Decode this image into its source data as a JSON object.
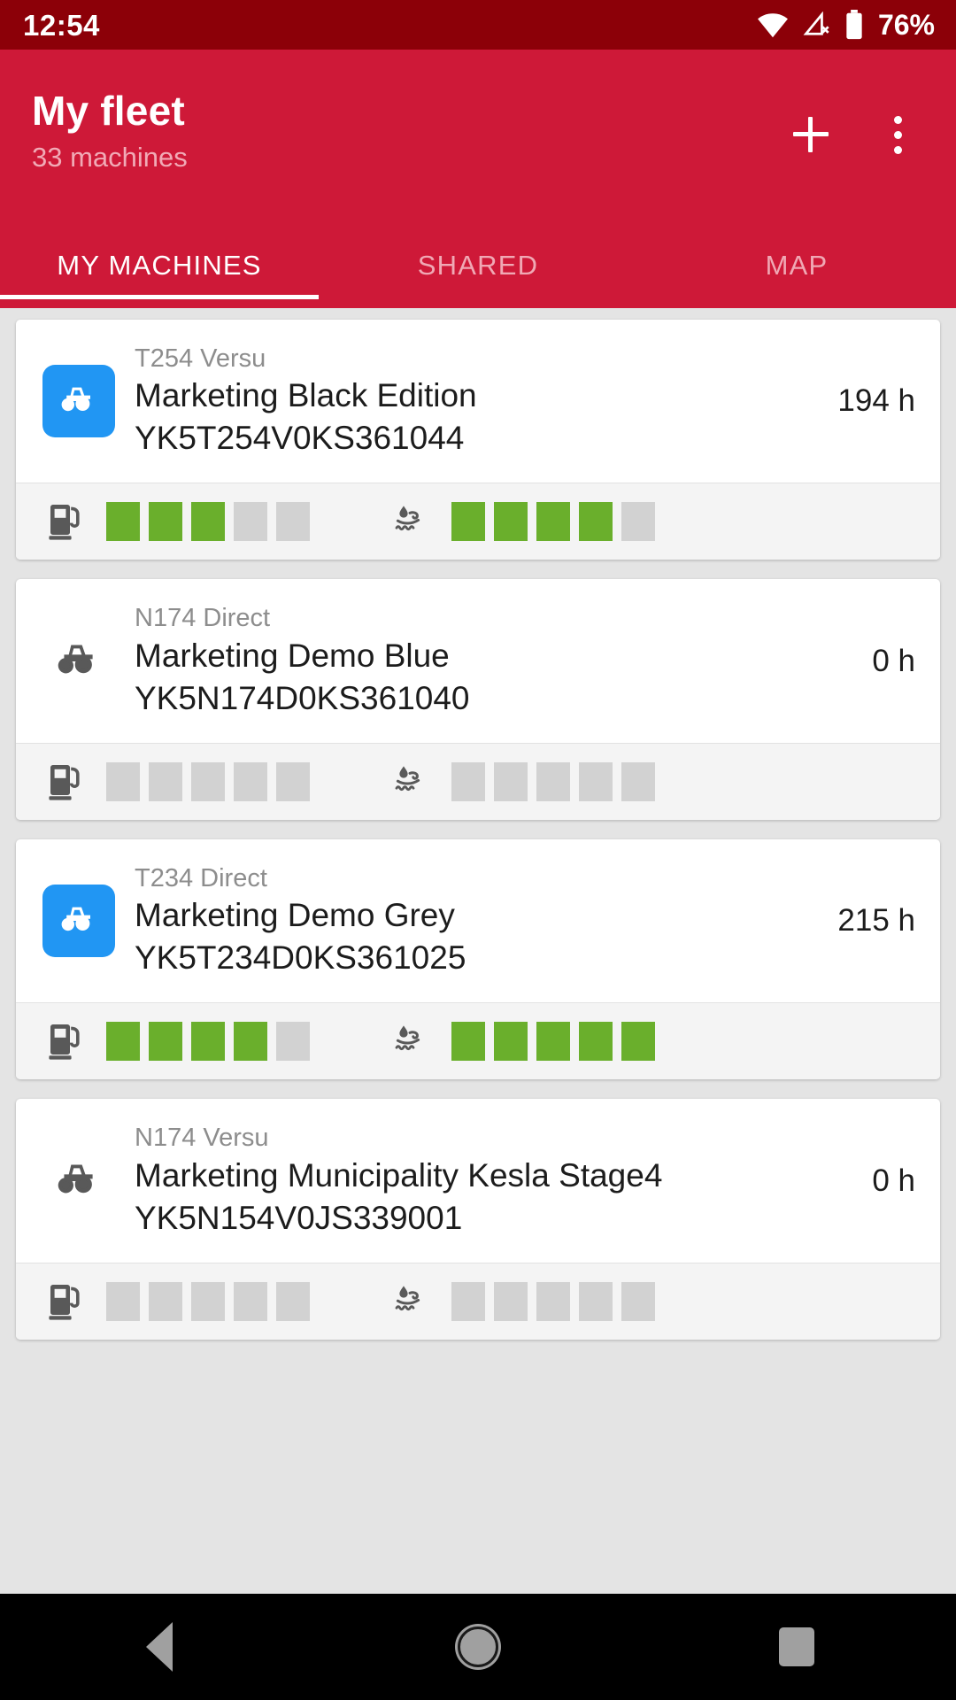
{
  "statusbar": {
    "time": "12:54",
    "battery_percent": "76%",
    "icons": [
      "wifi-icon",
      "cellular-off-icon",
      "battery-icon"
    ]
  },
  "appbar": {
    "title": "My fleet",
    "subtitle": "33 machines",
    "add_label": "+",
    "overflow_label": "More options",
    "background_color": "#ce1938",
    "status_background_color": "#8c0008"
  },
  "tabs": [
    {
      "label": "MY MACHINES",
      "active": true
    },
    {
      "label": "SHARED",
      "active": false
    },
    {
      "label": "MAP",
      "active": false
    }
  ],
  "gauge_colors": {
    "filled": "#6aaf2c",
    "empty": "#d2d2d2"
  },
  "machines": [
    {
      "model": "T254 Versu",
      "name": "Marketing Black Edition",
      "vin": "YK5T254V0KS361044",
      "hours": "194 h",
      "icon": "tractor-icon",
      "icon_highlighted": true,
      "fuel": {
        "icon": "fuel-pump-icon",
        "filled": 3,
        "total": 5
      },
      "def": {
        "icon": "def-exhaust-icon",
        "filled": 4,
        "total": 5
      }
    },
    {
      "model": "N174 Direct",
      "name": "Marketing Demo Blue",
      "vin": "YK5N174D0KS361040",
      "hours": "0 h",
      "icon": "tractor-icon",
      "icon_highlighted": false,
      "fuel": {
        "icon": "fuel-pump-icon",
        "filled": 0,
        "total": 5
      },
      "def": {
        "icon": "def-exhaust-icon",
        "filled": 0,
        "total": 5
      }
    },
    {
      "model": "T234 Direct",
      "name": "Marketing Demo Grey",
      "vin": "YK5T234D0KS361025",
      "hours": "215 h",
      "icon": "tractor-icon",
      "icon_highlighted": true,
      "fuel": {
        "icon": "fuel-pump-icon",
        "filled": 4,
        "total": 5
      },
      "def": {
        "icon": "def-exhaust-icon",
        "filled": 5,
        "total": 5
      }
    },
    {
      "model": "N174 Versu",
      "name": "Marketing Municipality Kesla Stage4",
      "vin": "YK5N154V0JS339001",
      "hours": "0 h",
      "icon": "tractor-icon",
      "icon_highlighted": false,
      "fuel": {
        "icon": "fuel-pump-icon",
        "filled": 0,
        "total": 5
      },
      "def": {
        "icon": "def-exhaust-icon",
        "filled": 0,
        "total": 5
      }
    }
  ],
  "navbar": {
    "back": "Back",
    "home": "Home",
    "recents": "Recents"
  }
}
